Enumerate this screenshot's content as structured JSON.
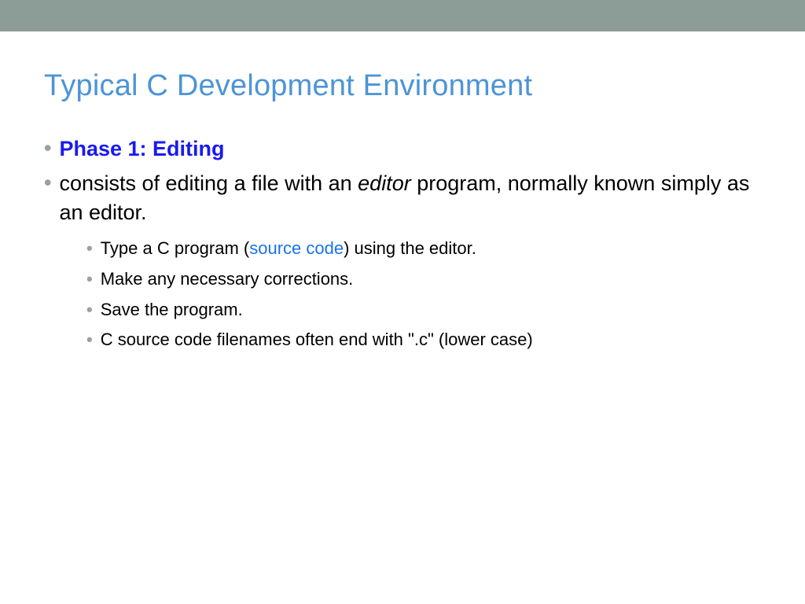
{
  "title": "Typical C Development Environment",
  "bullets": {
    "phase": "Phase 1:  Editing",
    "desc_pre": "consists of editing a file with an ",
    "desc_italic": "editor",
    "desc_post": " program, normally known simply as an editor."
  },
  "sub_bullets": {
    "s1_pre": "Type a C program (",
    "s1_link": "source code",
    "s1_post": ") using the editor.",
    "s2": "Make any necessary corrections.",
    "s3": "Save the program.",
    "s4": "C source code filenames often end with \".c\" (lower case)"
  }
}
